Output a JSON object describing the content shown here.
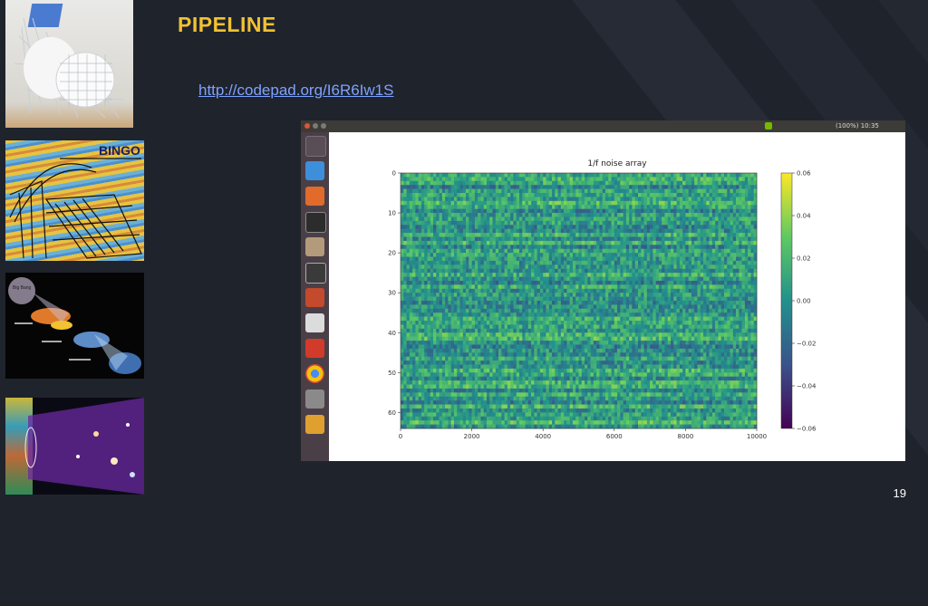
{
  "slide": {
    "title": "PIPELINE",
    "link": "http://codepad.org/I6R6Iw1S",
    "page_number": "19"
  },
  "thumbnails": [
    {
      "name": "telescope-render",
      "label": ""
    },
    {
      "name": "bingo-telescope-drawing",
      "label": "BINGO"
    },
    {
      "name": "cosmic-history-diagram",
      "label": "Big Bang"
    },
    {
      "name": "intensity-mapping-illustration",
      "label": ""
    }
  ],
  "screenshot": {
    "topbar_status": "(100%)  10:35",
    "launcher_icons": [
      "ubuntu-dash-icon",
      "dropbox-icon",
      "software-center-icon",
      "terminal-icon",
      "files-icon",
      "system-monitor-icon",
      "settings-icon",
      "text-editor-icon",
      "app-icon",
      "chrome-icon",
      "disks-icon",
      "stack-icon"
    ],
    "plot": {
      "title": "1/f noise array",
      "colorbar_ticks": [
        "0.06",
        "0.04",
        "0.02",
        "0.00",
        "−0.02",
        "−0.04",
        "−0.06"
      ]
    }
  },
  "chart_data": {
    "type": "heatmap",
    "title": "1/f noise array",
    "xlabel": "",
    "ylabel": "",
    "xlim": [
      0,
      10000
    ],
    "ylim": [
      64,
      0
    ],
    "x_ticks": [
      "0",
      "2000",
      "4000",
      "6000",
      "8000",
      "10000"
    ],
    "y_ticks": [
      "0",
      "10",
      "20",
      "30",
      "40",
      "50",
      "60"
    ],
    "colorbar": {
      "min": -0.06,
      "max": 0.06,
      "colormap": "viridis"
    },
    "rows": 64,
    "note": ""
  },
  "colors": {
    "background": "#1f232c",
    "title": "#f1c232",
    "link": "#7da2ff"
  }
}
